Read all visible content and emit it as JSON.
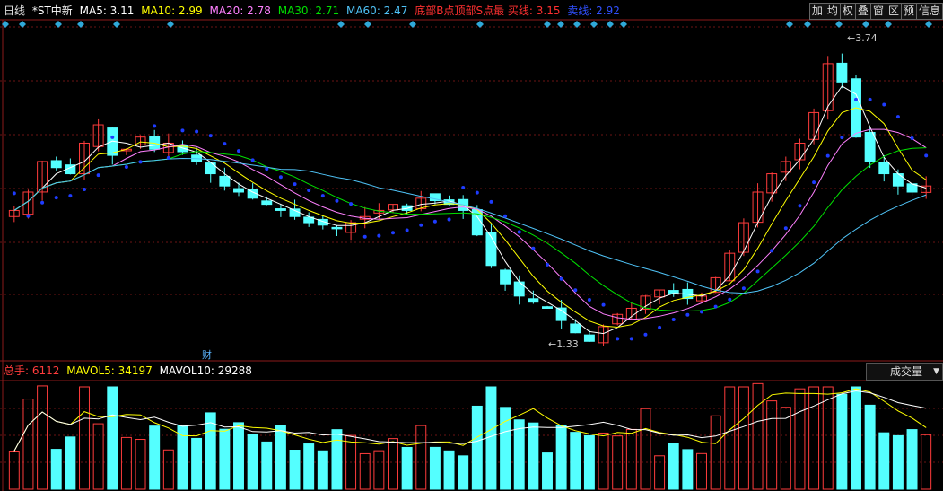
{
  "legend": {
    "period": "日线",
    "stock": "*ST中新",
    "ma5": "MA5: 3.11",
    "ma10": "MA10: 2.99",
    "ma20": "MA20: 2.78",
    "ma30": "MA30: 2.71",
    "ma60": "MA60: 2.47",
    "signal": "底部B点顶部S点最 买线: 3.15",
    "sell": "卖线: 2.92"
  },
  "toolbar": [
    "加",
    "均",
    "权",
    "叠",
    "窗",
    "区",
    "预",
    "信息"
  ],
  "volume_legend": {
    "total": "总手: 6112",
    "mavol5": "MAVOL5: 34197",
    "mavol10": "MAVOL10: 29288"
  },
  "volume_selector": "成交量",
  "cai_marker": "财",
  "high_label": "3.74",
  "low_label": "1.33",
  "colors": {
    "up": "#ff3c3c",
    "down": "#54ffff",
    "ma5": "#ffffff",
    "ma10": "#ffff00",
    "ma20": "#ff80ff",
    "ma30": "#00e000",
    "ma60": "#4fc3f7",
    "dots": "#1e3cff"
  },
  "chart_data": {
    "type": "candlestick",
    "y_range": [
      1.2,
      3.9
    ],
    "price_high": 3.74,
    "price_low": 1.33,
    "closes": [
      2.4,
      2.55,
      2.8,
      2.75,
      2.7,
      2.95,
      3.1,
      2.85,
      2.9,
      3.0,
      2.9,
      2.95,
      2.88,
      2.8,
      2.7,
      2.6,
      2.55,
      2.5,
      2.45,
      2.4,
      2.35,
      2.3,
      2.28,
      2.25,
      2.3,
      2.35,
      2.4,
      2.45,
      2.4,
      2.5,
      2.48,
      2.45,
      2.4,
      2.2,
      1.95,
      1.8,
      1.7,
      1.65,
      1.6,
      1.5,
      1.4,
      1.33,
      1.45,
      1.55,
      1.6,
      1.7,
      1.75,
      1.72,
      1.68,
      1.7,
      1.85,
      2.05,
      2.3,
      2.55,
      2.7,
      2.8,
      2.95,
      3.2,
      3.6,
      3.45,
      3.0,
      2.8,
      2.7,
      2.6,
      2.55,
      2.6
    ]
  }
}
